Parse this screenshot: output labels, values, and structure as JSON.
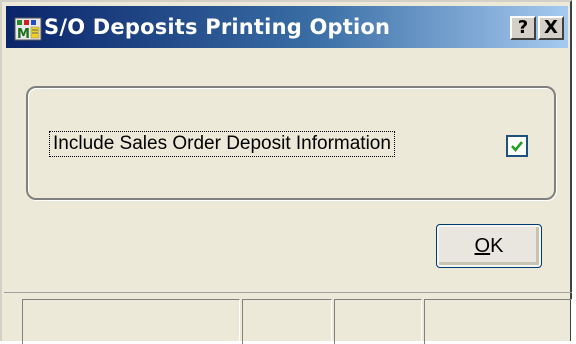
{
  "window": {
    "title": "S/O Deposits Printing Option",
    "help_label": "?",
    "close_label": "X"
  },
  "option": {
    "label": "Include Sales Order Deposit Information",
    "checked": true
  },
  "ok_button": {
    "mnemonic": "O",
    "rest": "K"
  },
  "statusbar": {
    "panels": [
      "",
      "",
      "",
      ""
    ]
  },
  "colors": {
    "title_start": "#0a246a",
    "title_end": "#a6caf0",
    "face": "#ece9d8",
    "check": "#21a121"
  }
}
